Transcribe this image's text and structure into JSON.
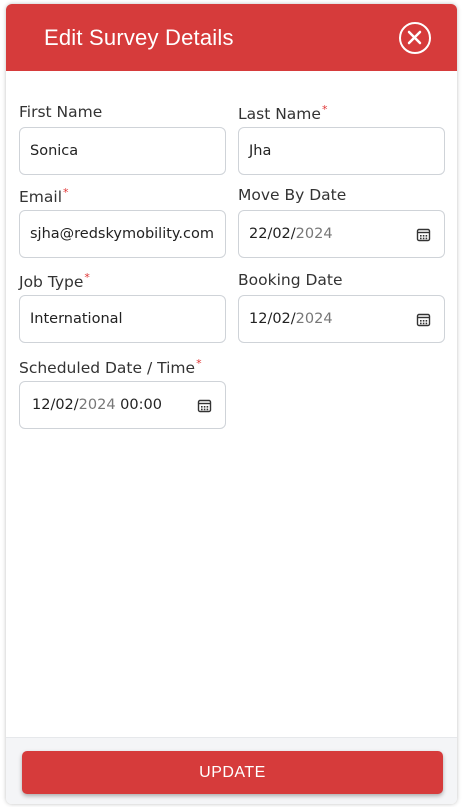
{
  "header": {
    "title": "Edit Survey Details",
    "close_icon": "close-circle-icon"
  },
  "form": {
    "first_name": {
      "label": "First Name",
      "value": "Sonica",
      "required": false
    },
    "last_name": {
      "label": "Last Name",
      "value": "Jha",
      "required": true
    },
    "email": {
      "label": "Email",
      "value": "sjha@redskymobility.com",
      "required": true
    },
    "move_by_date": {
      "label": "Move By Date",
      "value_main": "22/02/",
      "value_dim": "2024",
      "icon": "calendar-icon",
      "required": false
    },
    "job_type": {
      "label": "Job Type",
      "value": "International",
      "required": true
    },
    "booking_date": {
      "label": "Booking Date",
      "value_main": "12/02/",
      "value_dim": "2024",
      "icon": "calendar-icon",
      "required": false
    },
    "scheduled": {
      "label": "Scheduled Date / Time",
      "value_main": "12/02/",
      "value_dim": "2024",
      "value_time": " 00:00",
      "icon": "calendar-icon",
      "required": true
    },
    "required_marker": "*"
  },
  "footer": {
    "update_label": "UPDATE"
  },
  "colors": {
    "accent": "#d63b3b",
    "required": "#e03535"
  }
}
